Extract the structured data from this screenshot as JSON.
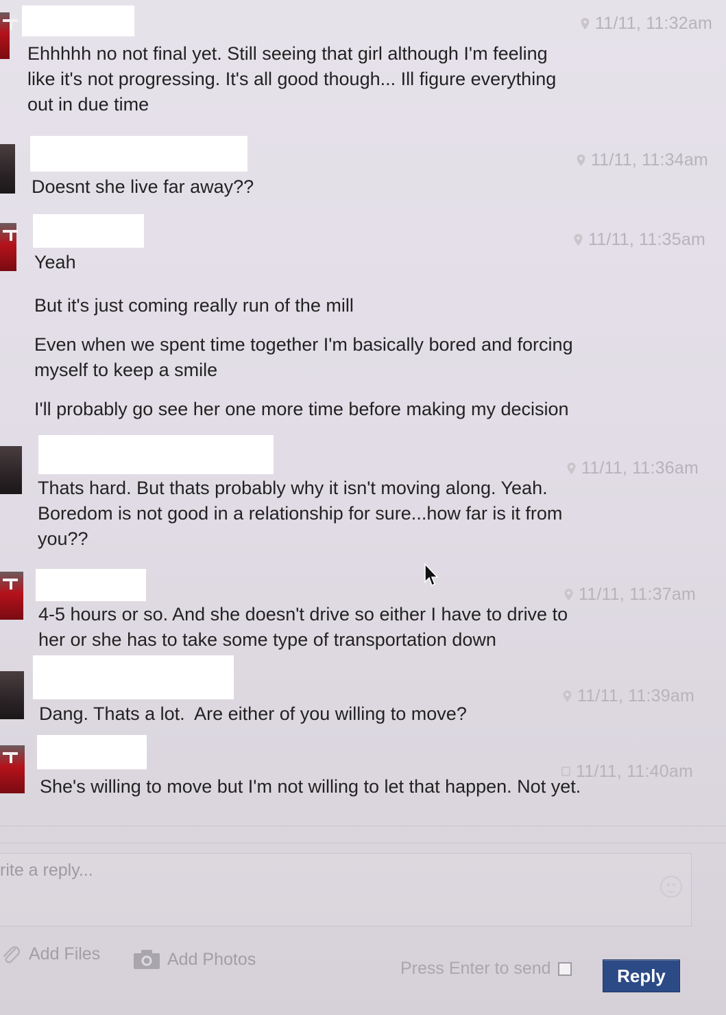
{
  "messages": [
    {
      "timestamp": "11/11, 11:32am",
      "lines": [
        "Ehhhhh no not final yet. Still seeing that girl although I'm feeling\nlike it's not progressing. It's all good though... Ill figure everything\nout in due time"
      ]
    },
    {
      "timestamp": "11/11, 11:34am",
      "lines": [
        "Doesnt she live far away??"
      ]
    },
    {
      "timestamp": "11/11, 11:35am",
      "lines": [
        "Yeah",
        "But it's just coming really run of the mill",
        "Even when we spent time together I'm basically bored and forcing\nmyself to keep a smile",
        "I'll probably go see her one more time before making my decision"
      ]
    },
    {
      "timestamp": "11/11, 11:36am",
      "lines": [
        "Thats hard. But thats probably why it isn't moving along. Yeah.\nBoredom is not good in a relationship for sure...how far is it from\nyou??"
      ]
    },
    {
      "timestamp": "11/11, 11:37am",
      "lines": [
        "4-5 hours or so. And she doesn't drive so either I have to drive to\nher or she has to take some type of transportation down"
      ]
    },
    {
      "timestamp": "11/11, 11:39am",
      "lines": [
        "Dang. Thats a lot.  Are either of you willing to move?"
      ]
    },
    {
      "timestamp": "11/11, 11:40am",
      "lines": [
        "She's willing to move but I'm not willing to let that happen. Not yet."
      ]
    }
  ],
  "composer": {
    "placeholder": "rite a reply...",
    "add_files": "Add Files",
    "add_photos": "Add Photos",
    "press_enter": "Press Enter to send",
    "reply": "Reply"
  },
  "colors": {
    "reply_button": "#2c4a86",
    "timestamp": "#b7b3ba",
    "redaction": "#ffffff"
  }
}
